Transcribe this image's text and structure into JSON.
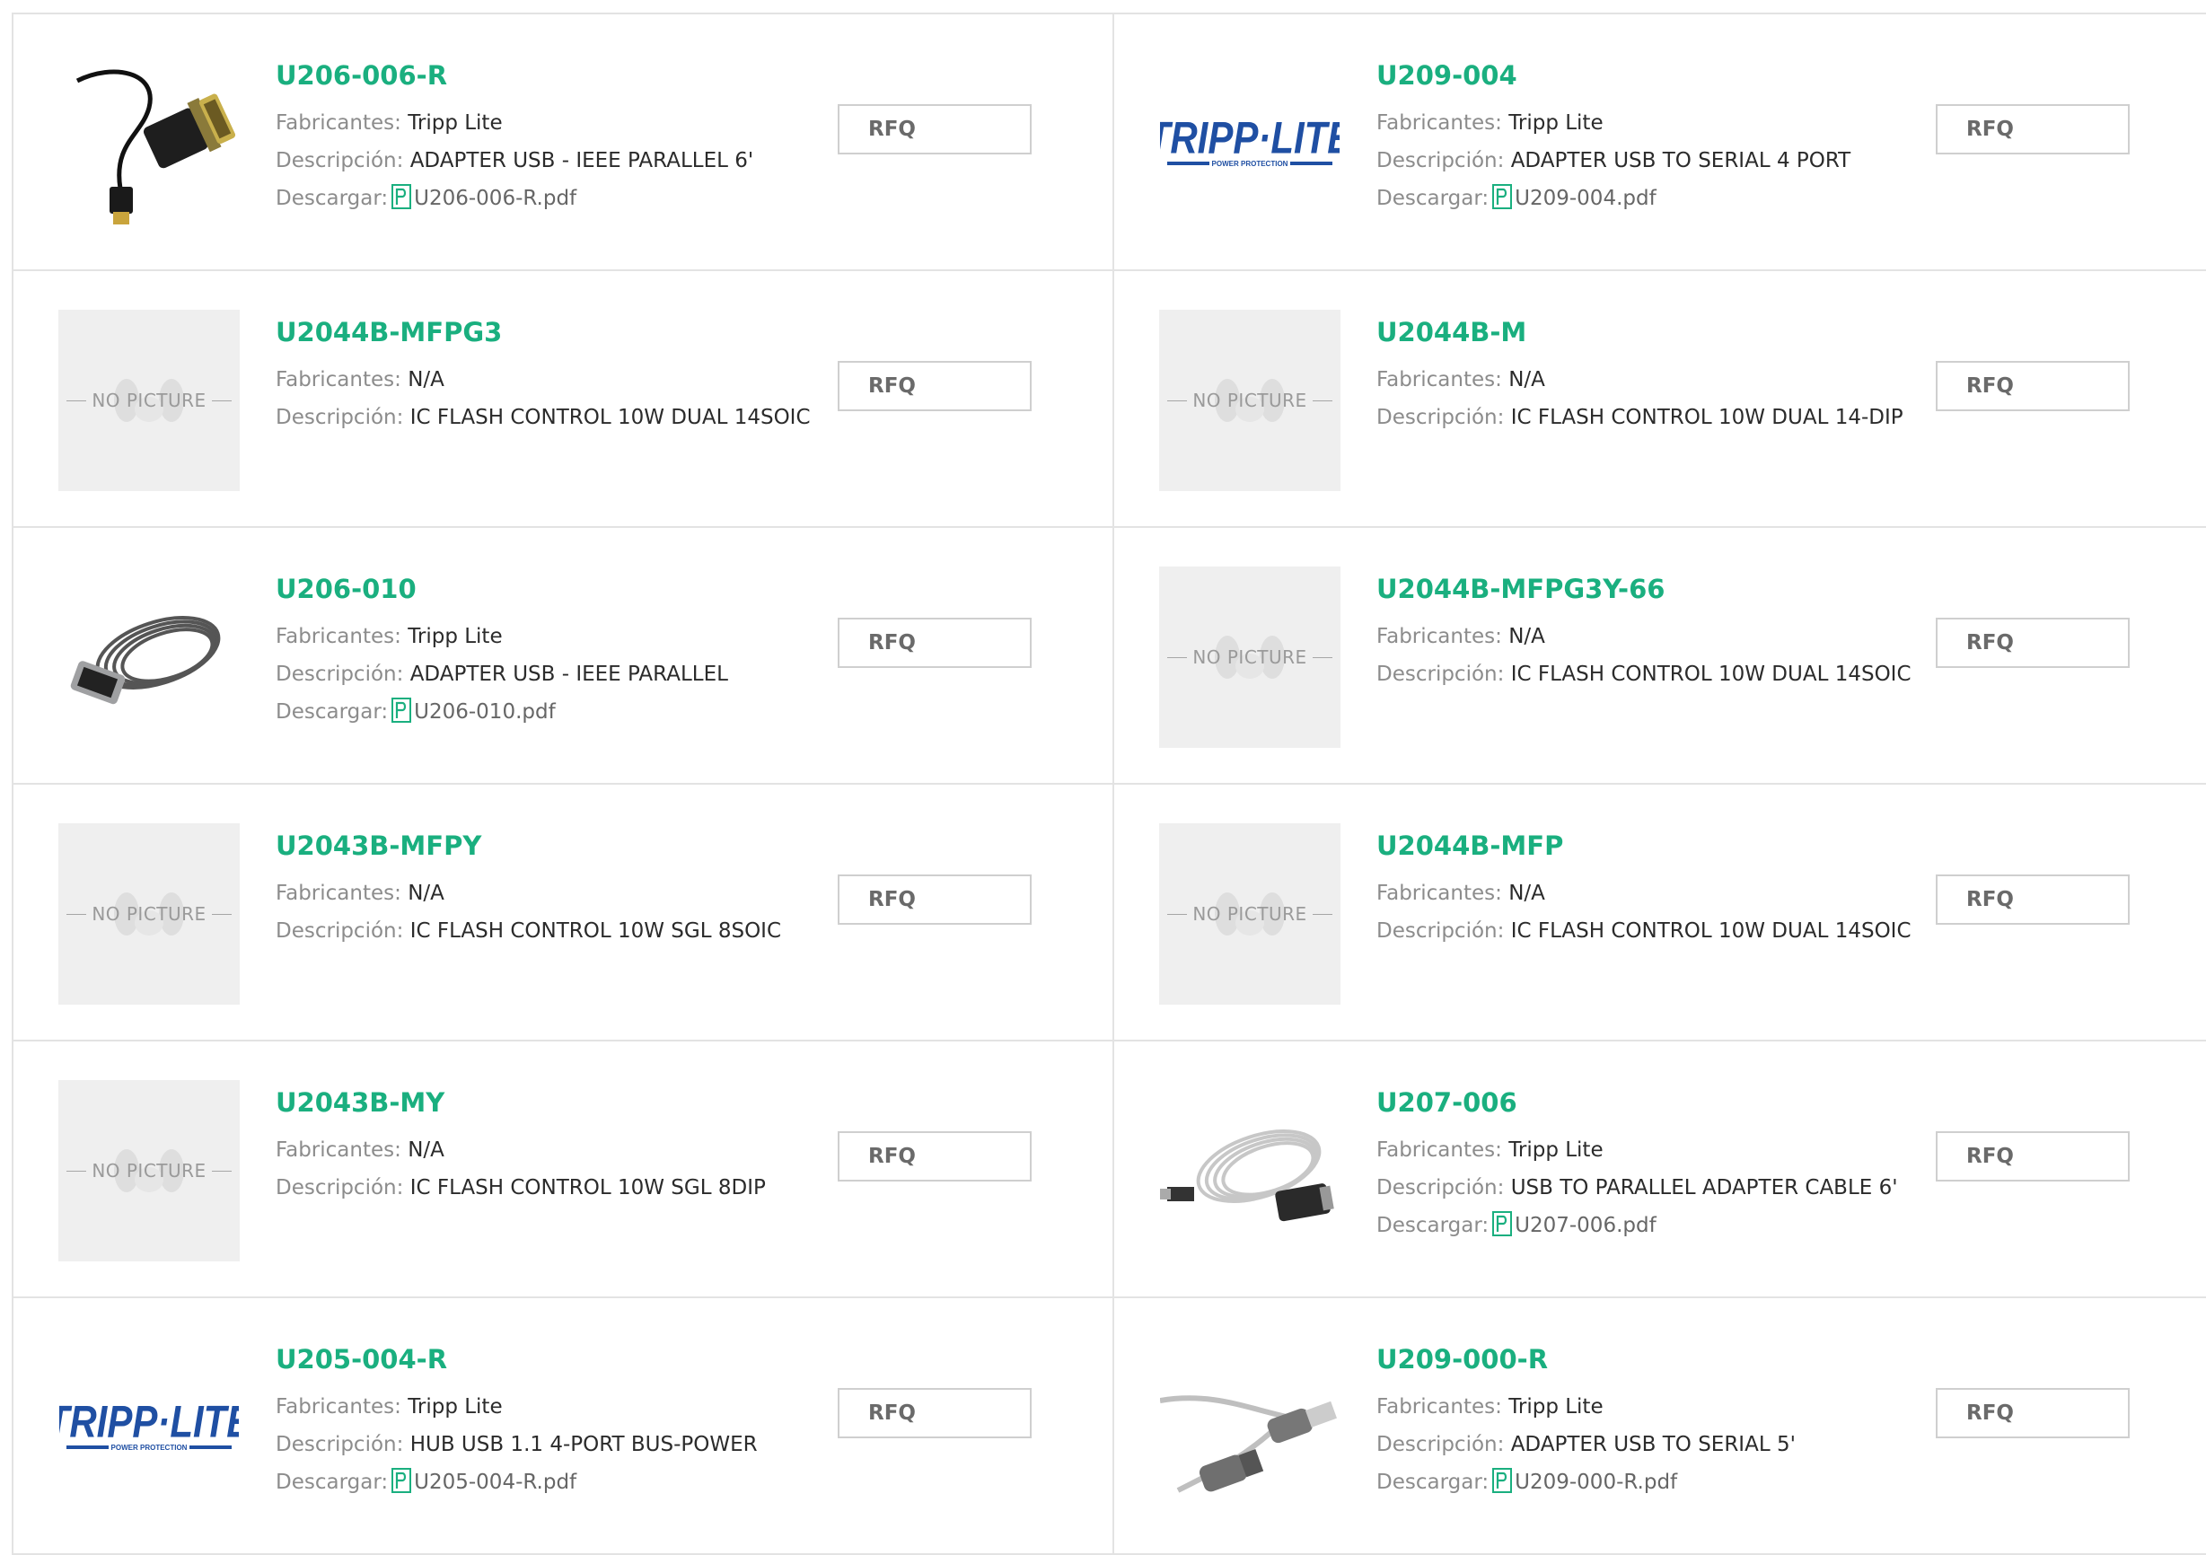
{
  "labels": {
    "manufacturer": "Fabricantes:",
    "description": "Descripción:",
    "download": "Descargar:",
    "rfq": "RFQ",
    "no_picture": "NO PICTURE"
  },
  "colors": {
    "part_link": "#1aaf7f",
    "border": "#e3e3e3",
    "tripp_blue": "#1f4fa3"
  },
  "products": [
    {
      "part": "U206-006-R",
      "manufacturer": "Tripp Lite",
      "description": "ADAPTER USB - IEEE PARALLEL 6'",
      "pdf": "U206-006-R.pdf",
      "image": "usb-parallel-adapter"
    },
    {
      "part": "U209-004",
      "manufacturer": "Tripp Lite",
      "description": "ADAPTER USB TO SERIAL 4 PORT",
      "pdf": "U209-004.pdf",
      "image": "tripp-lite-logo"
    },
    {
      "part": "U2044B-MFPG3",
      "manufacturer": "N/A",
      "description": "IC FLASH CONTROL 10W DUAL 14SOIC",
      "pdf": null,
      "image": "no-picture"
    },
    {
      "part": "U2044B-M",
      "manufacturer": "N/A",
      "description": "IC FLASH CONTROL 10W DUAL 14-DIP",
      "pdf": null,
      "image": "no-picture"
    },
    {
      "part": "U206-010",
      "manufacturer": "Tripp Lite",
      "description": "ADAPTER USB - IEEE PARALLEL",
      "pdf": "U206-010.pdf",
      "image": "coiled-parallel-cable"
    },
    {
      "part": "U2044B-MFPG3Y-66",
      "manufacturer": "N/A",
      "description": "IC FLASH CONTROL 10W DUAL 14SOIC",
      "pdf": null,
      "image": "no-picture"
    },
    {
      "part": "U2043B-MFPY",
      "manufacturer": "N/A",
      "description": "IC FLASH CONTROL 10W SGL 8SOIC",
      "pdf": null,
      "image": "no-picture"
    },
    {
      "part": "U2044B-MFP",
      "manufacturer": "N/A",
      "description": "IC FLASH CONTROL 10W DUAL 14SOIC",
      "pdf": null,
      "image": "no-picture"
    },
    {
      "part": "U2043B-MY",
      "manufacturer": "N/A",
      "description": "IC FLASH CONTROL 10W SGL 8DIP",
      "pdf": null,
      "image": "no-picture"
    },
    {
      "part": "U207-006",
      "manufacturer": "Tripp Lite",
      "description": "USB TO PARALLEL ADAPTER CABLE 6'",
      "pdf": "U207-006.pdf",
      "image": "coiled-usb-cable"
    },
    {
      "part": "U205-004-R",
      "manufacturer": "Tripp Lite",
      "description": "HUB USB 1.1 4-PORT BUS-POWER",
      "pdf": "U205-004-R.pdf",
      "image": "tripp-lite-logo"
    },
    {
      "part": "U209-000-R",
      "manufacturer": "Tripp Lite",
      "description": "ADAPTER USB TO SERIAL 5'",
      "pdf": "U209-000-R.pdf",
      "image": "usb-serial-cable"
    }
  ]
}
